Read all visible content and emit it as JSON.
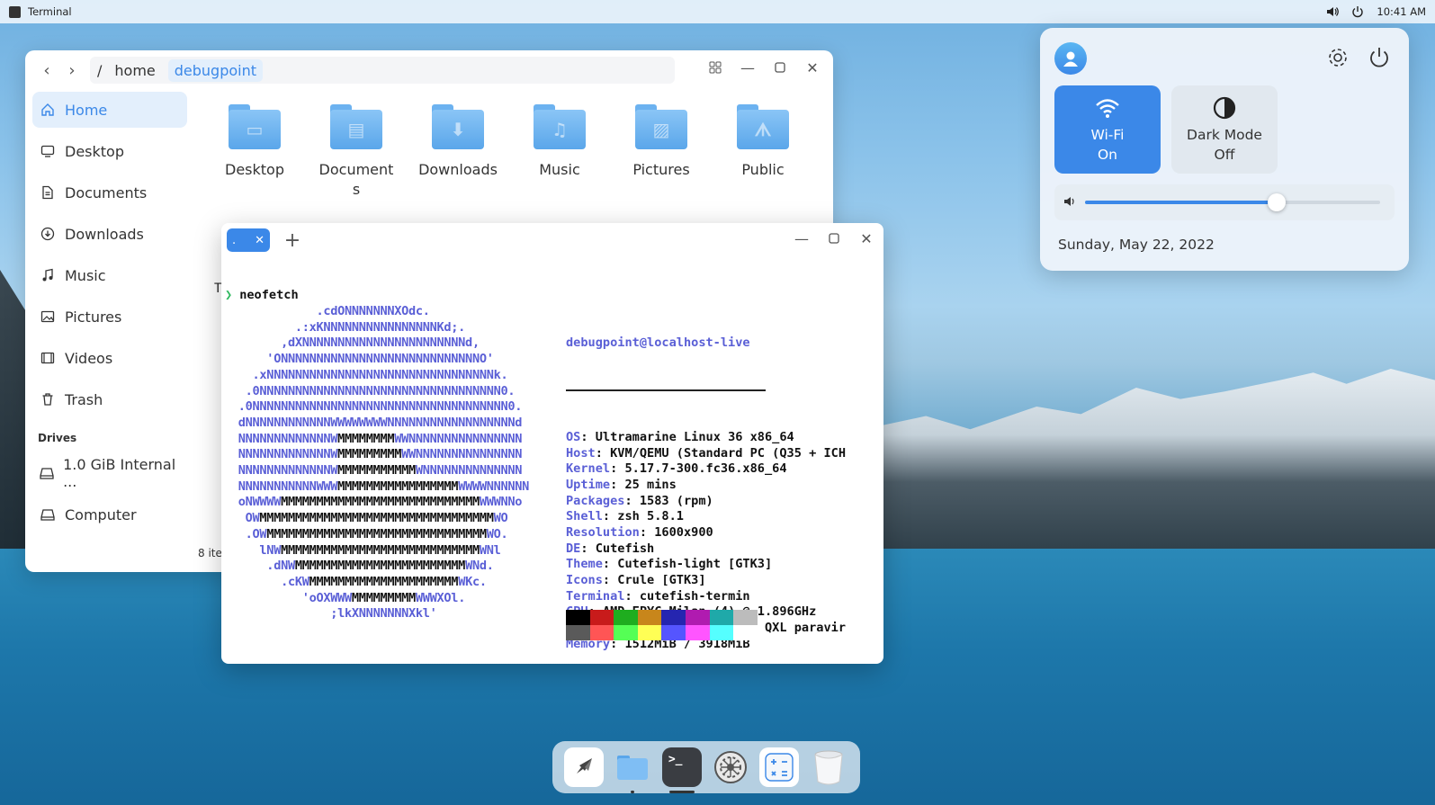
{
  "topbar": {
    "app_name": "Terminal",
    "time": "10:41 AM"
  },
  "file_manager": {
    "path": [
      "/",
      "home",
      "debugpoint"
    ],
    "sidebar": [
      {
        "label": "Home",
        "icon": "home-icon",
        "active": true
      },
      {
        "label": "Desktop",
        "icon": "monitor-icon"
      },
      {
        "label": "Documents",
        "icon": "document-icon"
      },
      {
        "label": "Downloads",
        "icon": "download-icon"
      },
      {
        "label": "Music",
        "icon": "music-icon"
      },
      {
        "label": "Pictures",
        "icon": "picture-icon"
      },
      {
        "label": "Videos",
        "icon": "video-icon"
      },
      {
        "label": "Trash",
        "icon": "trash-icon"
      }
    ],
    "drives_header": "Drives",
    "drives": [
      {
        "label": "1.0 GiB Internal ...",
        "icon": "drive-icon"
      },
      {
        "label": "Computer",
        "icon": "drive-icon"
      }
    ],
    "folders": [
      "Desktop",
      "Document\ns",
      "Downloads",
      "Music",
      "Pictures",
      "Public"
    ],
    "status": "8 ite"
  },
  "terminal": {
    "tab_label": ".",
    "command": "neofetch",
    "left_glyph": "T",
    "user_host": "debugpoint@localhost-live",
    "info": [
      {
        "key": "OS",
        "value": "Ultramarine Linux 36 x86_64"
      },
      {
        "key": "Host",
        "value": "KVM/QEMU (Standard PC (Q35 + ICH"
      },
      {
        "key": "Kernel",
        "value": "5.17.7-300.fc36.x86_64"
      },
      {
        "key": "Uptime",
        "value": "25 mins"
      },
      {
        "key": "Packages",
        "value": "1583 (rpm)"
      },
      {
        "key": "Shell",
        "value": "zsh 5.8.1"
      },
      {
        "key": "Resolution",
        "value": "1600x900"
      },
      {
        "key": "DE",
        "value": "Cutefish"
      },
      {
        "key": "Theme",
        "value": "Cutefish-light [GTK3]"
      },
      {
        "key": "Icons",
        "value": "Crule [GTK3]"
      },
      {
        "key": "Terminal",
        "value": "cutefish-termin"
      },
      {
        "key": "CPU",
        "value": "AMD EPYC-Milan (4) @ 1.896GHz"
      },
      {
        "key": "GPU",
        "value": "00:01.0 Red Hat, Inc. QXL paravir"
      },
      {
        "key": "Memory",
        "value": "1512MiB / 3918MiB"
      }
    ],
    "ascii": [
      "             .cdONNNNNNNXOdc.",
      "          .:xKNNNNNNNNNNNNNNNNKd;.",
      "        ,dXNNNNNNNNNNNNNNNNNNNNNNNd,",
      "      'ONNNNNNNNNNNNNNNNNNNNNNNNNNNNO'",
      "    .xNNNNNNNNNNNNNNNNNNNNNNNNNNNNNNNNk.",
      "   .0NNNNNNNNNNNNNNNNNNNNNNNNNNNNNNNNNN0.",
      "  .0NNNNNNNNNNNNNNNNNNNNNNNNNNNNNNNNNNNN0.",
      "  dNNNNNNNNNNNNWWWWWWWWNNNNNNNNNNNNNNNNNNd",
      "  NNNNNNNNNNNNNW[MMMMMMMM]WWNNNNNNNNNNNNNNNN",
      "  NNNNNNNNNNNNNW[MMMMMMMMM]WWNNNNNNNNNNNNNNN",
      "  NNNNNNNNNNNNNW[MMMMMMMMMMM]WNNNNNNNNNNNNNN",
      "  NNNNNNNNNNNWWW[MMMMMMMMMMMMMMMMM]WWWWNNNNNN",
      "  oNWWWW[MMMMMMMMMMMMMMMMMMMMMMMMMMMM]WWWNNo",
      "   OW[MMMMMMMMMMMMMMMMMMMMMMMMMMMMMMMMM]WO",
      "   .OW[MMMMMMMMMMMMMMMMMMMMMMMMMMMMMMM]WO.",
      "     lNW[MMMMMMMMMMMMMMMMMMMMMMMMMMMM]WNl",
      "      .dNW[MMMMMMMMMMMMMMMMMMMMMMMM]WNd.",
      "        .cKW[MMMMMMMMMMMMMMMMMMMMM]WKc.",
      "           'oOXWWW[MMMMMMMMM]WWWXOl.",
      "               ;lkXNNNNNNNXkl'"
    ],
    "colors": {
      "row1": [
        "#000000",
        "#c81b1b",
        "#1fad1f",
        "#c8861b",
        "#2525b0",
        "#b01bb0",
        "#1fa9a9",
        "#bcbcbc"
      ],
      "row2": [
        "#5a5a5a",
        "#ff5555",
        "#55ff55",
        "#ffff55",
        "#5555ff",
        "#ff55ff",
        "#55ffff",
        "#ffffff"
      ]
    }
  },
  "control_center": {
    "wifi_label": "Wi-Fi",
    "wifi_state": "On",
    "dark_label": "Dark Mode",
    "dark_state": "Off",
    "volume_level": 0.65,
    "date": "Sunday, May 22, 2022"
  },
  "dock": [
    {
      "name": "launcher-icon"
    },
    {
      "name": "file-manager-icon",
      "running": true
    },
    {
      "name": "terminal-icon",
      "running": true,
      "active": true
    },
    {
      "name": "settings-icon"
    },
    {
      "name": "calculator-icon"
    },
    {
      "name": "trash-icon"
    }
  ],
  "accent": "#3b88e8"
}
